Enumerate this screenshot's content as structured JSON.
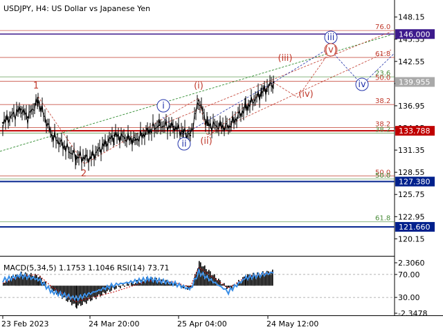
{
  "header": {
    "symbol_label": "USDJPY, H4:  US Dollar vs Japanese Yen"
  },
  "colors": {
    "background": "#ffffff",
    "candles": "#000000",
    "grid_major": "#000000",
    "purple_level": "#3d1a8c",
    "red_level": "#c00000",
    "blue_level": "#00208c",
    "fib_red": "#c0392b",
    "fib_green": "#4a8c3a",
    "wave_red": "#c0392b",
    "wave_blue": "#2233aa",
    "trend_green": "#2e8b2e",
    "macd_hist": "#000000",
    "rsi_line": "#3a8ee6",
    "price_tag_gray": "#a9a9a9"
  },
  "chart_data": [
    {
      "type": "line",
      "title": "",
      "symbol": "USDJPY, H4",
      "description": "US Dollar vs Japanese Yen",
      "xlabel": "",
      "ylabel": "",
      "x_ticks": [
        "23 Feb 2023",
        "24 Mar 20:00",
        "25 Apr 04:00",
        "24 May 12:00"
      ],
      "y_ticks": [
        148.15,
        145.35,
        142.55,
        139.75,
        136.95,
        134.15,
        131.35,
        128.55,
        125.75,
        122.95,
        120.15
      ],
      "ylim": [
        118.0,
        150.3
      ],
      "grid": false,
      "series": [
        {
          "x": [
            "23 Feb 2023",
            "02 Mar",
            "06 Mar",
            "08 Mar",
            "13 Mar",
            "20 Mar",
            "24 Mar",
            "29 Mar",
            "03 Apr",
            "10 Apr",
            "14 Apr",
            "20 Apr",
            "24 Apr",
            "27 Apr",
            "02 May",
            "04 May",
            "10 May",
            "15 May",
            "19 May",
            "24 May"
          ],
          "values": [
            134.8,
            136.5,
            135.5,
            137.6,
            133.2,
            130.5,
            130.3,
            133.2,
            132.6,
            133.8,
            134.5,
            134.3,
            133.6,
            133.2,
            137.6,
            134.5,
            134.3,
            136.7,
            138.6,
            139.9
          ]
        }
      ],
      "price_tags": [
        {
          "value": "146.000",
          "color": "#3d1a8c"
        },
        {
          "value": "139.955",
          "color": "#a9a9a9"
        },
        {
          "value": "133.788",
          "color": "#c00000"
        },
        {
          "value": "127.380",
          "color": "#00208c"
        },
        {
          "value": "121.660",
          "color": "#00208c"
        }
      ],
      "fib_labels": [
        {
          "text": "76.0",
          "value": 146.45,
          "color": "#c0392b"
        },
        {
          "text": "61.8",
          "value": 143.05,
          "color": "#c0392b"
        },
        {
          "text": "23.6",
          "value": 140.6,
          "color": "#4a8c3a"
        },
        {
          "text": "50.0",
          "value": 140.05,
          "color": "#c0392b"
        },
        {
          "text": "38.2",
          "value": 137.1,
          "color": "#c0392b"
        },
        {
          "text": "38.2",
          "value": 134.2,
          "color": "#c0392b"
        },
        {
          "text": "38.2",
          "value": 133.5,
          "color": "#4a8c3a"
        },
        {
          "text": "50.0",
          "value": 128.1,
          "color": "#c0392b"
        },
        {
          "text": "50.0",
          "value": 127.7,
          "color": "#4a8c3a"
        },
        {
          "text": "61.8",
          "value": 122.3,
          "color": "#4a8c3a"
        }
      ],
      "wave_labels": [
        {
          "text": "1",
          "style": "plain",
          "color": "#c0392b"
        },
        {
          "text": "2",
          "style": "plain",
          "color": "#c0392b"
        },
        {
          "text": "i",
          "style": "circled",
          "color": "#2233aa"
        },
        {
          "text": "ii",
          "style": "circled",
          "color": "#2233aa"
        },
        {
          "text": "iii",
          "style": "circled",
          "color": "#2233aa"
        },
        {
          "text": "iv",
          "style": "circled",
          "color": "#2233aa"
        },
        {
          "text": "(i)",
          "style": "paren",
          "color": "#c0392b"
        },
        {
          "text": "(ii)",
          "style": "paren",
          "color": "#c0392b"
        },
        {
          "text": "(iii)",
          "style": "paren",
          "color": "#c0392b"
        },
        {
          "text": "(iv)",
          "style": "paren",
          "color": "#c0392b"
        },
        {
          "text": "(v)",
          "style": "paren-circled",
          "color": "#c0392b"
        }
      ],
      "legend_position": "none"
    },
    {
      "type": "line",
      "title": "",
      "indicator_label": "MACD(5,34,5) 1.1753 1.1046 RSI(14) 73.71",
      "y_ticks": [
        "2.3060",
        "70.00",
        "30.00",
        "-2.3478"
      ],
      "macd": {
        "x": [
          "23 Feb 2023",
          "02 Mar",
          "08 Mar",
          "13 Mar",
          "20 Mar",
          "29 Mar",
          "10 Apr",
          "20 Apr",
          "27 Apr",
          "02 May",
          "10 May",
          "15 May",
          "24 May"
        ],
        "histogram": [
          0.3,
          1.0,
          0.8,
          -0.4,
          -1.7,
          -0.2,
          0.6,
          0.2,
          -0.3,
          1.9,
          -0.3,
          0.8,
          1.1753
        ],
        "signal": [
          0.2,
          0.8,
          0.9,
          -0.1,
          -1.3,
          -0.5,
          0.4,
          0.3,
          -0.1,
          1.5,
          -0.2,
          0.7,
          1.1046
        ]
      },
      "rsi": {
        "x": [
          "23 Feb 2023",
          "02 Mar",
          "08 Mar",
          "13 Mar",
          "20 Mar",
          "29 Mar",
          "10 Apr",
          "20 Apr",
          "27 Apr",
          "02 May",
          "10 May",
          "15 May",
          "24 May"
        ],
        "values": [
          60,
          68,
          62,
          40,
          28,
          52,
          62,
          55,
          44,
          74,
          40,
          64,
          73.71
        ]
      },
      "legend_position": "none"
    }
  ]
}
